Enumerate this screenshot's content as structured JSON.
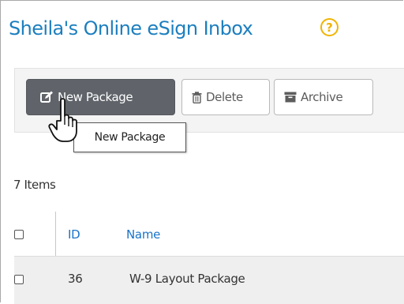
{
  "header": {
    "title": "Sheila's Online eSign Inbox",
    "help_icon": "question-circle-icon",
    "help_symbol": "?"
  },
  "toolbar": {
    "new_package_label": "New Package",
    "new_package_icon": "edit-icon",
    "delete_label": "Delete",
    "delete_icon": "trash-icon",
    "archive_label": "Archive",
    "archive_icon": "archive-icon",
    "tooltip": "New Package"
  },
  "list": {
    "item_count": "7 Items",
    "columns": [
      "ID",
      "Name"
    ],
    "rows": [
      {
        "id": "36",
        "name": "W-9 Layout Package",
        "checked": false
      }
    ]
  },
  "colors": {
    "title": "#1d7fbf",
    "help_icon": "#f0b400",
    "primary_button": "#60646a",
    "column_header": "#1a73c9",
    "row_background": "#efefef"
  }
}
